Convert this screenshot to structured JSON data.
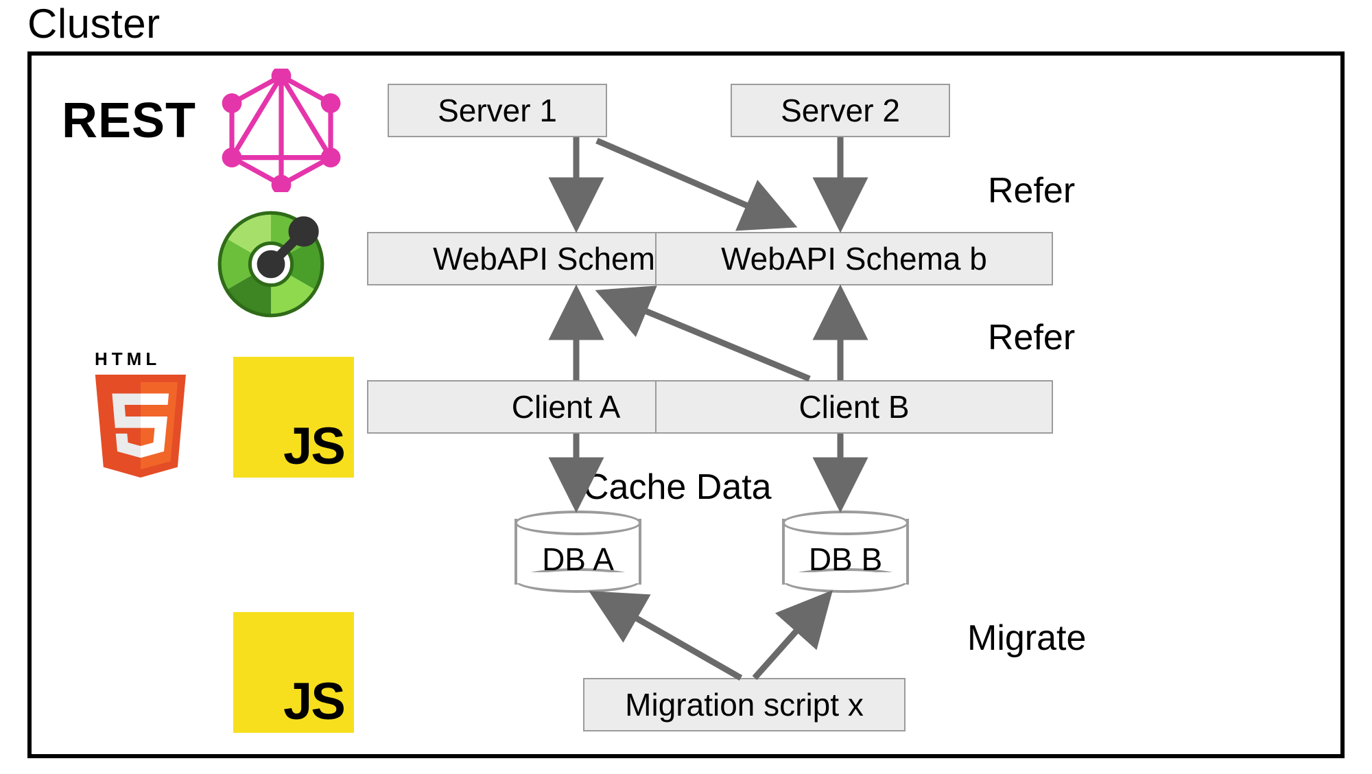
{
  "title": "Cluster",
  "rest_label": "REST",
  "nodes": {
    "server1": "Server 1",
    "server2": "Server 2",
    "schema_a": "WebAPI Schema a",
    "schema_b": "WebAPI Schema b",
    "client_a": "Client A",
    "client_b": "Client B",
    "db_a": "DB A",
    "db_b": "DB B",
    "migration": "Migration script x"
  },
  "edge_labels": {
    "refer_top": "Refer",
    "refer_mid": "Refer",
    "cache": "Cache Data",
    "migrate": "Migrate"
  },
  "icons": {
    "graphql": "graphql-icon",
    "openapi": "openapi-icon",
    "html5": "html5-icon",
    "js": "js-icon"
  },
  "badges": {
    "html5_word": "HTML",
    "html5_num": "5",
    "js_text": "JS"
  }
}
